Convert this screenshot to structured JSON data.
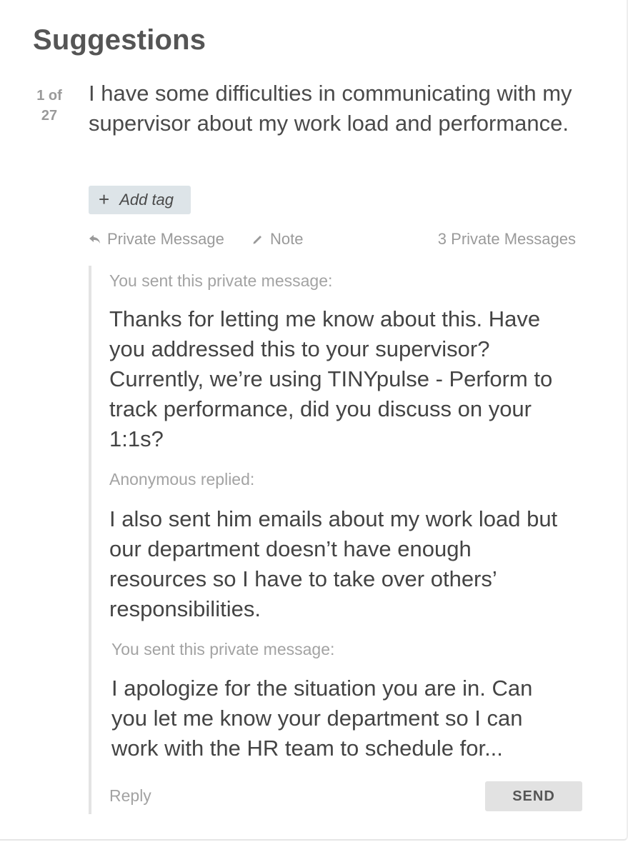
{
  "page": {
    "title": "Suggestions"
  },
  "counter": {
    "current": "1 of",
    "total": "27"
  },
  "question": {
    "text": "I have some difficulties in communicating with my supervisor about my work load and performance."
  },
  "tag": {
    "icon": "plus-icon",
    "label": "Add tag"
  },
  "actions": {
    "private_message": {
      "icon": "reply-arrow-icon",
      "label": "Private Message"
    },
    "note": {
      "icon": "pencil-icon",
      "label": "Note"
    },
    "private_message_count": "3 Private Messages"
  },
  "thread": {
    "messages": [
      {
        "meta": "You sent this private message:",
        "text": "Thanks for letting me know about this. Have you addressed this to your supervisor? Currently, we’re using TINYpulse - Perform to track performance, did you discuss on your 1:1s?"
      },
      {
        "meta": "Anonymous replied:",
        "text": "I also sent him emails about my work load but our department doesn’t have enough resources so I have to take over others’ responsibilities."
      },
      {
        "meta": "You sent this private message:",
        "text": "I apologize for the situation you are in. Can you let me know your department so I can work with the HR team to schedule for..."
      }
    ],
    "reply_placeholder": "Reply",
    "send_label": "SEND"
  },
  "colors": {
    "tag_background": "#dde4e8",
    "thread_border": "#e3e3e3",
    "send_background": "#e2e2e2",
    "muted_text": "#9a9a9a"
  }
}
